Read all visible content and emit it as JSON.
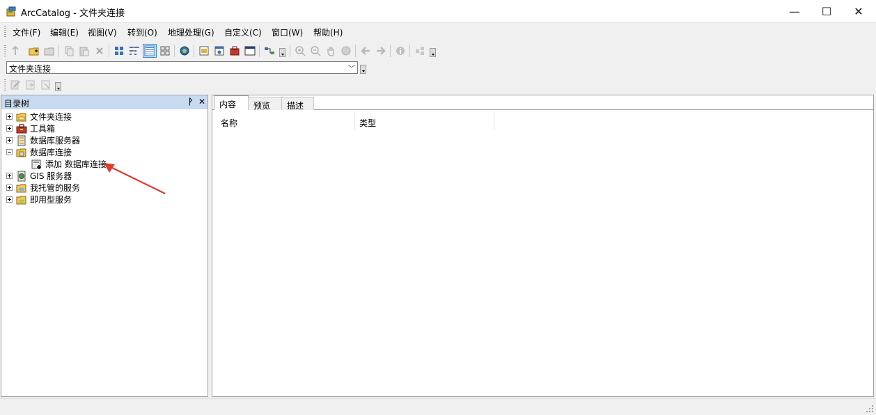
{
  "window": {
    "title": "ArcCatalog - 文件夹连接",
    "minimize_glyph": "—",
    "maximize_glyph": "☐",
    "close_glyph": "✕"
  },
  "menu": [
    "文件(F)",
    "编辑(E)",
    "视图(V)",
    "转到(O)",
    "地理处理(G)",
    "自定义(C)",
    "窗口(W)",
    "帮助(H)"
  ],
  "location": {
    "value": "文件夹连接"
  },
  "catalog_tree": {
    "title": "目录树",
    "pin_glyph": "ᚹ",
    "close_glyph": "✕",
    "items": [
      {
        "label": "文件夹连接",
        "icon": "folder-connection-icon",
        "expander": "plus"
      },
      {
        "label": "工具箱",
        "icon": "toolbox-icon",
        "expander": "plus"
      },
      {
        "label": "数据库服务器",
        "icon": "database-server-icon",
        "expander": "plus"
      },
      {
        "label": "数据库连接",
        "icon": "database-connection-icon",
        "expander": "minus"
      },
      {
        "label": "添加 数据库连接",
        "icon": "add-database-connection-icon",
        "expander": "none"
      },
      {
        "label": "GIS 服务器",
        "icon": "gis-server-icon",
        "expander": "plus"
      },
      {
        "label": "我托管的服务",
        "icon": "hosted-services-icon",
        "expander": "plus"
      },
      {
        "label": "即用型服务",
        "icon": "ready-to-use-services-icon",
        "expander": "plus"
      }
    ]
  },
  "content": {
    "tabs": [
      "内容",
      "预览",
      "描述"
    ],
    "columns": [
      "名称",
      "类型"
    ]
  },
  "colors": {
    "panel_header": "#c8daf0",
    "selection": "#cce4f7",
    "annotation_arrow": "#e03a2e"
  }
}
